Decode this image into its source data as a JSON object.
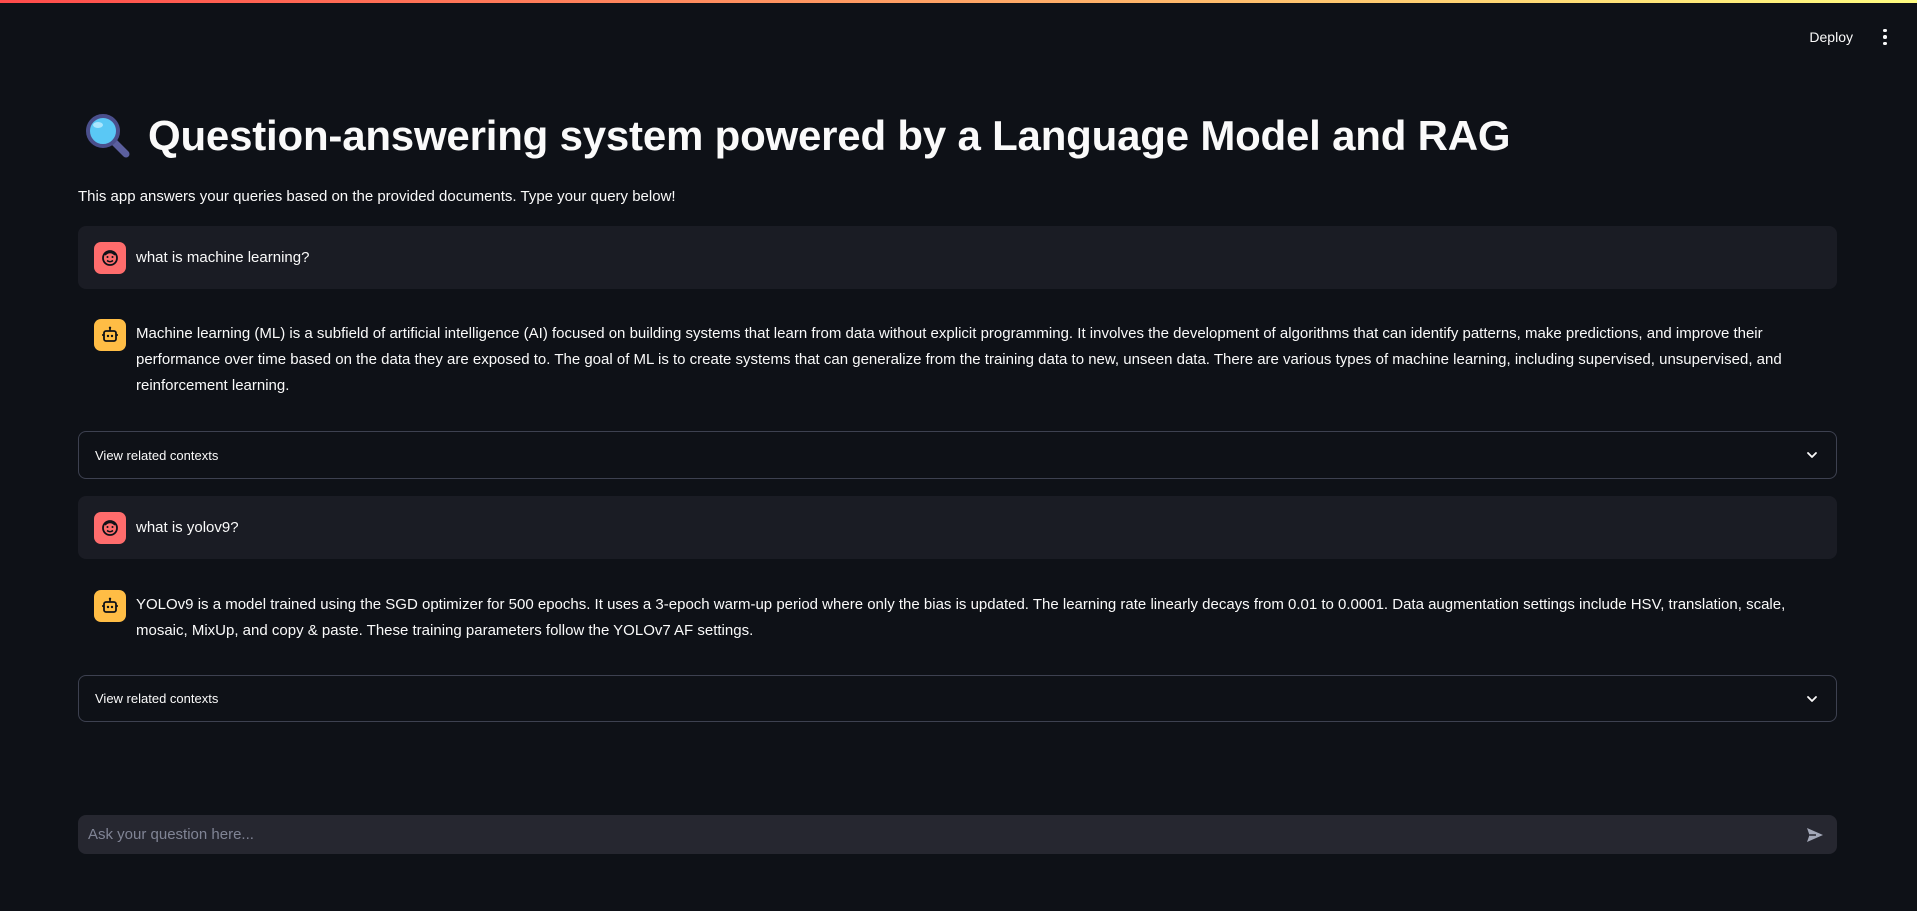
{
  "header": {
    "deploy_label": "Deploy",
    "menu_icon": "kebab-menu-icon"
  },
  "main": {
    "title": "Question-answering system powered by a Language Model and RAG",
    "title_icon": "magnifying-glass-icon",
    "subtitle": "This app answers your queries based on the provided documents. Type your query below!"
  },
  "messages": [
    {
      "role": "user",
      "text": "what is machine learning?"
    },
    {
      "role": "assistant",
      "text": "Machine learning (ML) is a subfield of artificial intelligence (AI) focused on building systems that learn from data without explicit programming. It involves the development of algorithms that can identify patterns, make predictions, and improve their performance over time based on the data they are exposed to. The goal of ML is to create systems that can generalize from the training data to new, unseen data. There are various types of machine learning, including supervised, unsupervised, and reinforcement learning."
    },
    {
      "role": "expander",
      "text": "View related contexts"
    },
    {
      "role": "user",
      "text": "what is yolov9?"
    },
    {
      "role": "assistant",
      "text": "YOLOv9 is a model trained using the SGD optimizer for 500 epochs. It uses a 3-epoch warm-up period where only the bias is updated. The learning rate linearly decays from 0.01 to 0.0001. Data augmentation settings include HSV, translation, scale, mosaic, MixUp, and copy & paste. These training parameters follow the YOLOv7 AF settings."
    },
    {
      "role": "expander",
      "text": "View related contexts"
    }
  ],
  "chat_input": {
    "placeholder": "Ask your question here...",
    "value": ""
  },
  "colors": {
    "background": "#0e1117",
    "user_avatar": "#ff6c6c",
    "bot_avatar": "#ffbd45",
    "message_bg": "#1a1c24",
    "input_bg": "#262730"
  }
}
